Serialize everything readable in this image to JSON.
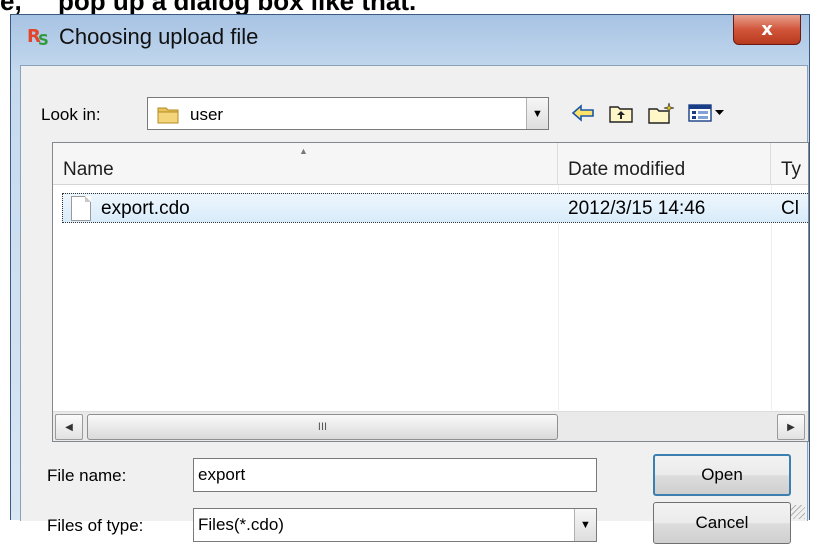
{
  "caption": {
    "prefix": "e,",
    "text": "pop up a dialog box like that."
  },
  "window": {
    "title": "Choosing upload file",
    "icon": "rs-app-icon",
    "close_label": "x"
  },
  "look_in": {
    "label": "Look in:",
    "value": "user"
  },
  "toolbar": [
    {
      "name": "back-arrow-icon",
      "glyph": "⇦"
    },
    {
      "name": "up-folder-icon",
      "glyph": "📁"
    },
    {
      "name": "new-folder-icon",
      "glyph": "✳"
    },
    {
      "name": "view-menu-icon",
      "glyph": "▦"
    }
  ],
  "file_list": {
    "columns": [
      "Name",
      "Date modified",
      "Ty"
    ],
    "rows": [
      {
        "name": "export.cdo",
        "date": "2012/3/15 14:46",
        "type": "Cl"
      }
    ],
    "scrollbar_grip": "III"
  },
  "file_name": {
    "label": "File name:",
    "value": "export"
  },
  "file_type": {
    "label": "Files of type:",
    "value": "Files(*.cdo)"
  },
  "buttons": {
    "open": "Open",
    "cancel": "Cancel"
  }
}
